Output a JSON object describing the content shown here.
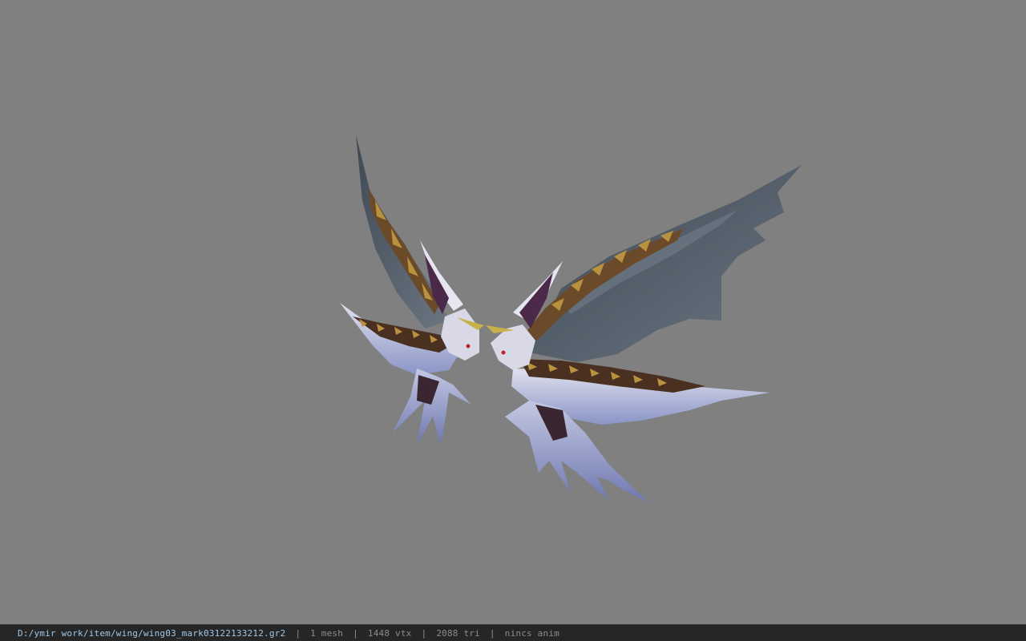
{
  "viewer": {
    "background_color": "#808080",
    "model": {
      "name": "wing-model",
      "colors": {
        "feather_dark": "#4b5560",
        "feather_mid": "#5e6874",
        "feather_light": "#c9cbe0",
        "feather_blue": "#8b97c6",
        "bone_purple": "#4a2a48",
        "scales_brown": "#6b4a2a",
        "scales_gold": "#b8923e",
        "beak_gold": "#c8b04a"
      }
    }
  },
  "status": {
    "file_path": "D:/ymir work/item/wing/wing03_mark03122133212.gr2",
    "mesh": "1 mesh",
    "vtx": "1448 vtx",
    "tri": "2088 tri",
    "anim": "nincs anim",
    "separator": "|"
  }
}
